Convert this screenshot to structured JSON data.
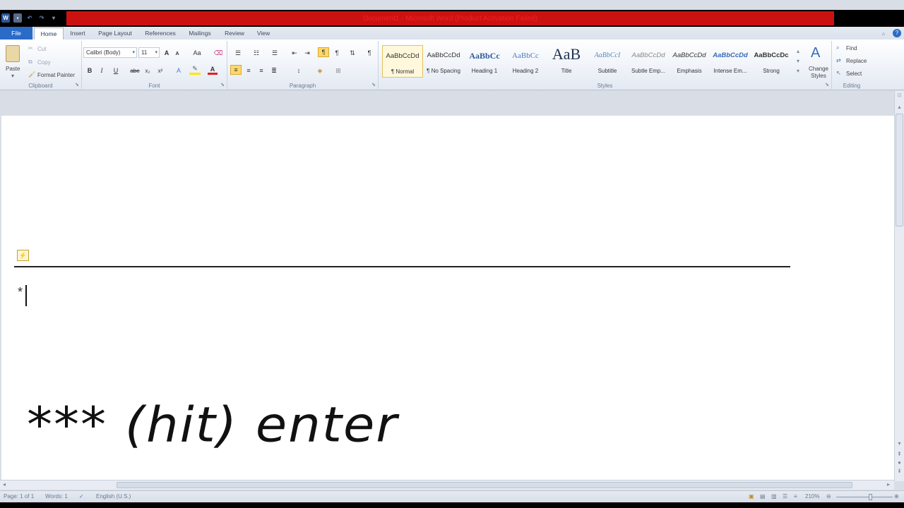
{
  "window": {
    "title": "Document1 - Microsoft Word (Product Activation Failed)"
  },
  "qat": {
    "word_icon": "W"
  },
  "tabs": [
    "File",
    "Home",
    "Insert",
    "Page Layout",
    "References",
    "Mailings",
    "Review",
    "View"
  ],
  "clipboard": {
    "paste": "Paste",
    "cut": "Cut",
    "copy": "Copy",
    "format_painter": "Format Painter",
    "label": "Clipboard"
  },
  "font": {
    "name": "Calibri (Body)",
    "size": "11",
    "label": "Font",
    "bold": "B",
    "italic": "I",
    "underline": "U",
    "strike": "abe",
    "sub": "x₂",
    "sup": "x²",
    "grow": "A",
    "shrink": "A",
    "case": "Aa",
    "color": "A"
  },
  "paragraph": {
    "label": "Paragraph",
    "pilcrow": "¶"
  },
  "styles": {
    "label": "Styles",
    "items": [
      {
        "sample": "AaBbCcDd",
        "name": "¶ Normal"
      },
      {
        "sample": "AaBbCcDd",
        "name": "¶ No Spacing"
      },
      {
        "sample": "AaBbCc",
        "name": "Heading 1"
      },
      {
        "sample": "AaBbCc",
        "name": "Heading 2"
      },
      {
        "sample": "AaB",
        "name": "Title"
      },
      {
        "sample": "AaBbCcI",
        "name": "Subtitle"
      },
      {
        "sample": "AaBbCcDd",
        "name": "Subtle Emp..."
      },
      {
        "sample": "AaBbCcDd",
        "name": "Emphasis"
      },
      {
        "sample": "AaBbCcDd",
        "name": "Intense Em..."
      },
      {
        "sample": "AaBbCcDc",
        "name": "Strong"
      }
    ],
    "change_styles": "Change Styles"
  },
  "editing": {
    "label": "Editing",
    "find": "Find",
    "replace": "Replace",
    "select": "Select"
  },
  "document": {
    "typed_text": "*",
    "annotation": "*** (hit) enter"
  },
  "status": {
    "page": "Page: 1 of 1",
    "words": "Words: 1",
    "language": "English (U.S.)",
    "zoom": "210%"
  },
  "colors": {
    "file_tab": "#2a6bc8",
    "title_strip": "#cc1111",
    "highlight": "#ffe37a"
  }
}
